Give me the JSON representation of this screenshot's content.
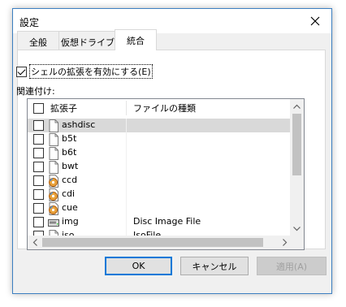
{
  "window": {
    "title": "設定",
    "close_icon": "close-icon"
  },
  "tabs": [
    {
      "label": "全般",
      "active": false
    },
    {
      "label": "仮想ドライブ",
      "active": false
    },
    {
      "label": "統合",
      "active": true
    }
  ],
  "shell_option": {
    "label": "シェルの拡張を有効にする(E)",
    "checked": true
  },
  "associations_label": "関連付け:",
  "list": {
    "columns": [
      "拡張子",
      "ファイルの種類"
    ],
    "rows": [
      {
        "ext": "ashdisc",
        "type": "",
        "icon": "blank-file-icon",
        "checked": false,
        "selected": true
      },
      {
        "ext": "b5t",
        "type": "",
        "icon": "blank-file-icon",
        "checked": false,
        "selected": false
      },
      {
        "ext": "b6t",
        "type": "",
        "icon": "blank-file-icon",
        "checked": false,
        "selected": false
      },
      {
        "ext": "bwt",
        "type": "",
        "icon": "blank-file-icon",
        "checked": false,
        "selected": false
      },
      {
        "ext": "ccd",
        "type": "",
        "icon": "disc-file-icon",
        "checked": false,
        "selected": false
      },
      {
        "ext": "cdi",
        "type": "",
        "icon": "disc-file-icon",
        "checked": false,
        "selected": false
      },
      {
        "ext": "cue",
        "type": "",
        "icon": "disc-file-icon",
        "checked": false,
        "selected": false
      },
      {
        "ext": "img",
        "type": "Disc Image File",
        "icon": "drive-file-icon",
        "checked": false,
        "selected": false
      },
      {
        "ext": "iso",
        "type": "IsoFile",
        "icon": "blank-file-icon",
        "checked": false,
        "selected": false
      }
    ]
  },
  "buttons": {
    "ok": "OK",
    "cancel": "キャンセル",
    "apply": "適用(A)"
  },
  "colors": {
    "accent": "#0078d7",
    "selection": "#d9d9d9",
    "dialog_bg": "#f0f0f0"
  }
}
